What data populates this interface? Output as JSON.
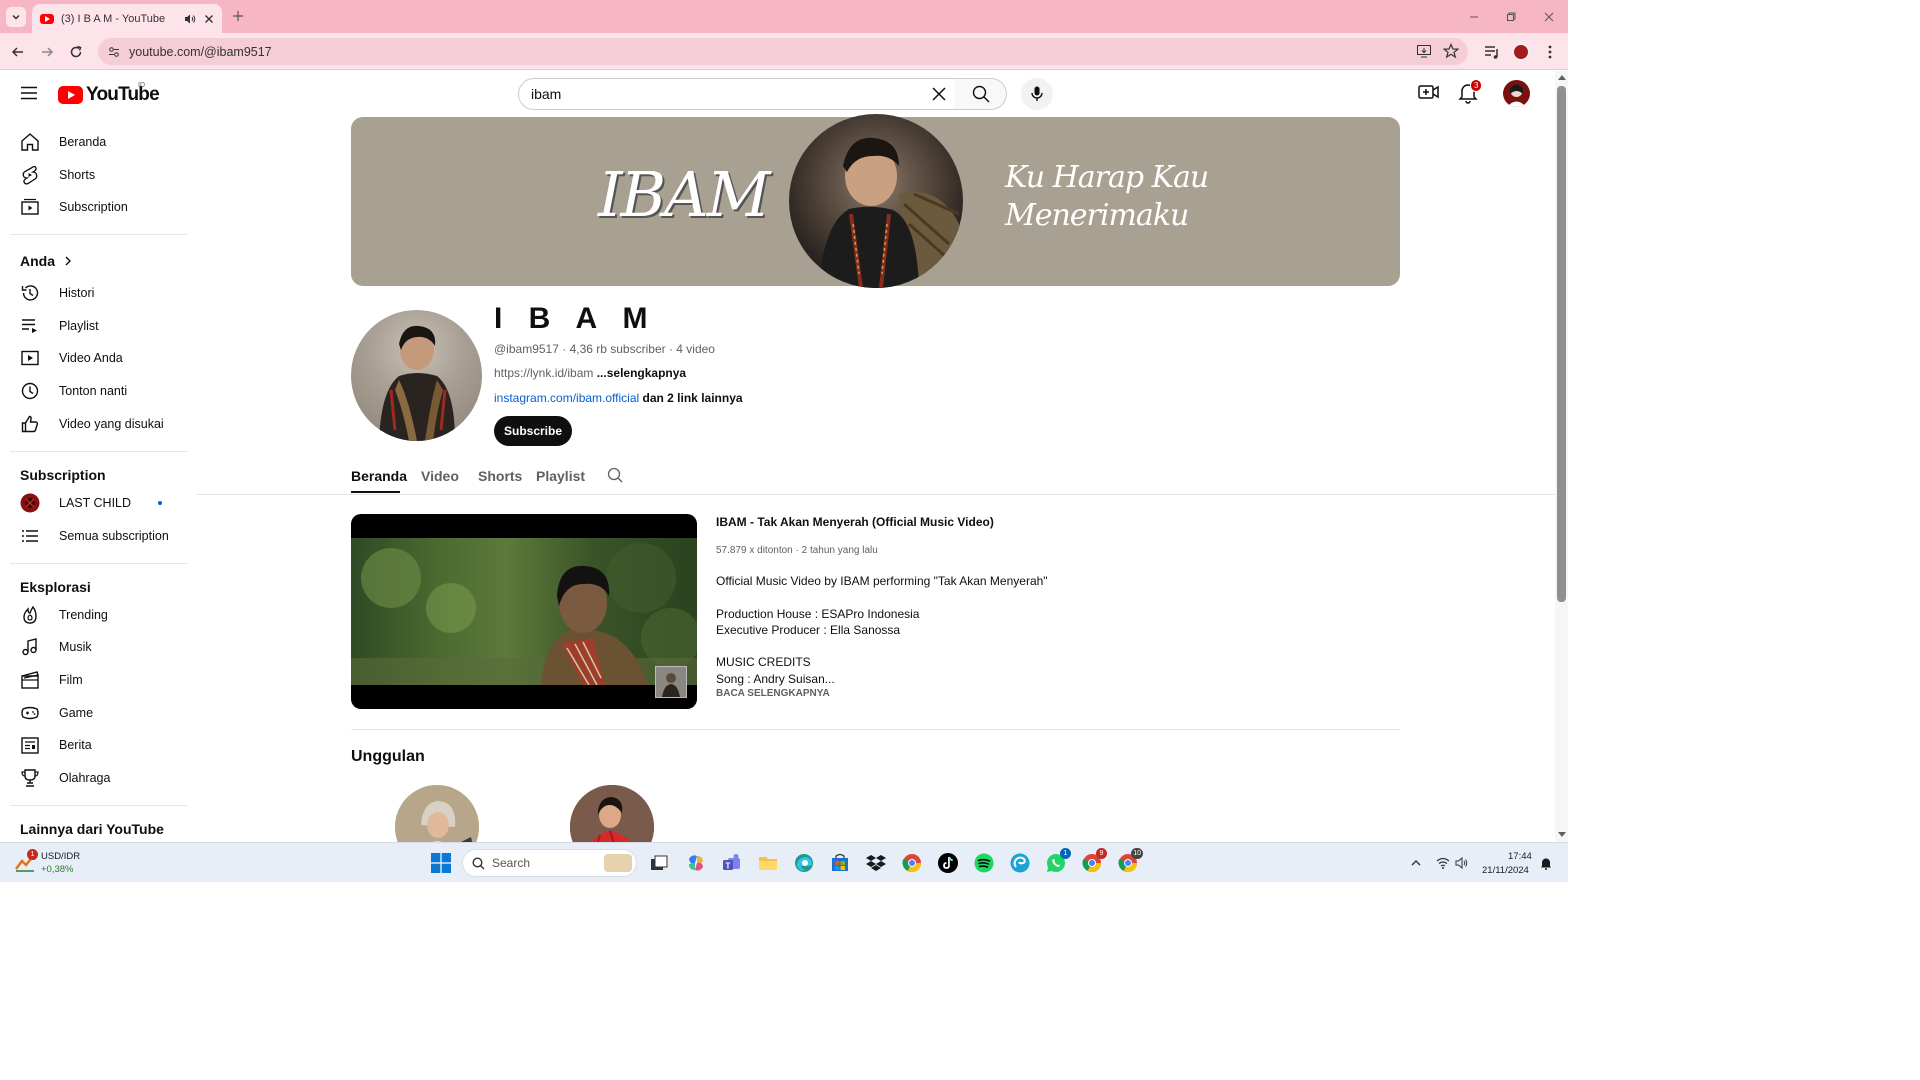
{
  "browser": {
    "tab_title": "(3) I B A M - YouTube",
    "url": "youtube.com/@ibam9517",
    "accent_color": "#f6b6c4"
  },
  "youtube": {
    "logo_text": "YouTube",
    "country_code": "ID",
    "search_value": "ibam",
    "notification_count": "3"
  },
  "sidebar": {
    "main_items": [
      {
        "label": "Beranda",
        "icon": "home-icon"
      },
      {
        "label": "Shorts",
        "icon": "shorts-icon"
      },
      {
        "label": "Subscription",
        "icon": "subscriptions-icon"
      }
    ],
    "you_heading": "Anda",
    "you_items": [
      {
        "label": "Histori",
        "icon": "history-icon"
      },
      {
        "label": "Playlist",
        "icon": "playlist-icon"
      },
      {
        "label": "Video Anda",
        "icon": "your-videos-icon"
      },
      {
        "label": "Tonton nanti",
        "icon": "watch-later-icon"
      },
      {
        "label": "Video yang disukai",
        "icon": "liked-videos-icon"
      }
    ],
    "subscription_heading": "Subscription",
    "subscriptions": [
      {
        "label": "LAST CHILD",
        "icon": "channel-avatar-icon",
        "new_content": true
      },
      {
        "label": "Semua subscription",
        "icon": "list-icon"
      }
    ],
    "explore_heading": "Eksplorasi",
    "explore_items": [
      {
        "label": "Trending",
        "icon": "trending-icon"
      },
      {
        "label": "Musik",
        "icon": "music-icon"
      },
      {
        "label": "Film",
        "icon": "film-icon"
      },
      {
        "label": "Game",
        "icon": "gaming-icon"
      },
      {
        "label": "Berita",
        "icon": "news-icon"
      },
      {
        "label": "Olahraga",
        "icon": "sports-icon"
      }
    ],
    "more_heading": "Lainnya dari YouTube"
  },
  "channel": {
    "banner_logo": "IBAM",
    "banner_tagline_1": "Ku Harap Kau",
    "banner_tagline_2": "Menerimaku",
    "name": "I B A M",
    "handle": "@ibam9517",
    "subscribers": "4,36 rb subscriber",
    "video_count": "4 video",
    "meta_separator": " · ",
    "description": "https://lynk.id/ibam ",
    "description_more": "...selengkapnya",
    "link_primary": "instagram.com/ibam.official",
    "link_more": " dan 2 link lainnya",
    "subscribe_label": "Subscribe",
    "tabs": [
      "Beranda",
      "Video",
      "Shorts",
      "Playlist"
    ],
    "active_tab": "Beranda"
  },
  "featured_video": {
    "title": "IBAM - Tak Akan Menyerah (Official Music Video)",
    "views": "57.879 x ditonton",
    "age": "2 tahun yang lalu",
    "description": "Official Music Video by IBAM performing \"Tak Akan Menyerah\"\n\nProduction House : ESAPro Indonesia\nExecutive Producer : Ella Sanossa\n\nMUSIC CREDITS\nSong : Andry Suisan...",
    "read_more": "BACA SELENGKAPNYA"
  },
  "featured_section": {
    "heading": "Unggulan"
  },
  "taskbar": {
    "ticker_name": "USD/IDR",
    "ticker_value": "+0,38%",
    "weather_badge": "1",
    "search_placeholder": "Search",
    "apps": [
      {
        "name": "file-manager-icon"
      },
      {
        "name": "copilot-icon"
      },
      {
        "name": "teams-icon"
      },
      {
        "name": "folder-icon"
      },
      {
        "name": "edge-icon"
      },
      {
        "name": "store-icon"
      },
      {
        "name": "dropbox-icon"
      },
      {
        "name": "chrome-icon"
      },
      {
        "name": "tiktok-icon"
      },
      {
        "name": "spotify-icon"
      },
      {
        "name": "edge-dev-icon"
      },
      {
        "name": "whatsapp-icon",
        "badge": "1"
      },
      {
        "name": "chrome-profile-icon",
        "badge": "9"
      },
      {
        "name": "chrome-profile-2-icon",
        "badge": "10"
      }
    ],
    "time": "17:44",
    "date": "21/11/2024"
  }
}
